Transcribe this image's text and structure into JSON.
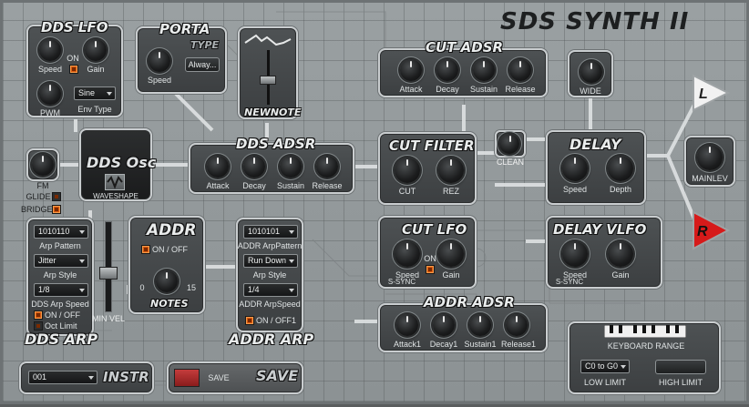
{
  "app_title": "SDS SYNTH II",
  "dds_lfo": {
    "title": "DDS LFO",
    "speed": "Speed",
    "on": "ON",
    "gain": "Gain",
    "pwm": "PWM",
    "env_type_value": "Sine",
    "env_type": "Env Type"
  },
  "porta": {
    "title": "PORTA",
    "type": "TYPE",
    "speed": "Speed",
    "type_value": "Alway..."
  },
  "newnote": {
    "title": "NEWNOTE"
  },
  "cut_adsr": {
    "title": "CUT ADSR",
    "attack": "Attack",
    "decay": "Decay",
    "sustain": "Sustain",
    "release": "Release"
  },
  "wide": {
    "label": "WIDE"
  },
  "fm": {
    "label": "FM",
    "glide": "GLIDE",
    "bridge": "BRIDGE"
  },
  "dds_osc": {
    "title": "DDS Osc",
    "waveshape": "WAVESHAPE"
  },
  "dds_adsr": {
    "title": "DDS ADSR",
    "attack": "Attack",
    "decay": "Decay",
    "sustain": "Sustain",
    "release": "Release"
  },
  "cut_filter": {
    "title": "CUT FILTER",
    "cut": "CUT",
    "rez": "REZ"
  },
  "clean": {
    "label": "CLEAN"
  },
  "delay": {
    "title": "DELAY",
    "speed": "Speed",
    "depth": "Depth"
  },
  "outputs": {
    "left": "L",
    "right": "R",
    "mainlev": "MAINLEV"
  },
  "dds_arp": {
    "title": "DDS ARP",
    "arp_pattern_value": "1010110",
    "arp_pattern": "Arp Pattern",
    "arp_style_value": "Jitter",
    "arp_style": "Arp Style",
    "arp_speed_value": "1/8",
    "arp_speed": "DDS Arp Speed",
    "on_off": "ON / OFF",
    "oct_limit": "Oct Limit",
    "min_vel": "MIN VEL"
  },
  "addr": {
    "title": "ADDR",
    "on_off": "ON / OFF",
    "min": "0",
    "max": "15",
    "notes": "NOTES"
  },
  "addr_arp": {
    "title": "ADDR ARP",
    "pattern_value": "1010101",
    "pattern": "ADDR ArpPattern",
    "style_value": "Run Down",
    "style": "Arp Style",
    "speed_value": "1/4",
    "speed": "ADDR ArpSpeed",
    "on_off": "ON / OFF1"
  },
  "cut_lfo": {
    "title": "CUT LFO",
    "speed": "Speed",
    "on": "ON",
    "gain": "Gain",
    "ssync": "S-SYNC"
  },
  "delay_vlfo": {
    "title": "DELAY VLFO",
    "speed": "Speed",
    "gain": "Gain",
    "ssync": "S-SYNC"
  },
  "addr_adsr": {
    "title": "ADDR ADSR",
    "attack": "Attack1",
    "decay": "Decay1",
    "sustain": "Sustain1",
    "release": "Release1"
  },
  "instr": {
    "value": "001",
    "label": "INSTR"
  },
  "save": {
    "small": "SAVE",
    "big": "SAVE"
  },
  "keyboard_range": {
    "title": "KEYBOARD RANGE",
    "low_value": "C0  to G0",
    "low": "LOW LIMIT",
    "high": "HIGH LIMIT"
  }
}
